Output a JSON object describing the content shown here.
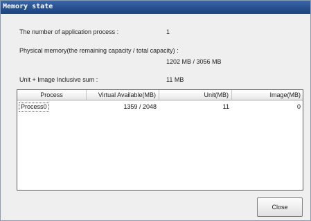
{
  "window": {
    "title": "Memory state"
  },
  "info": {
    "process_count_label": "The number of application process :",
    "process_count_value": "1",
    "physical_memory_label": "Physical memory(the remaining capacity / total capacity) :",
    "physical_memory_value": "1202 MB / 3056 MB",
    "inclusive_sum_label": "Unit + Image Inclusive sum :",
    "inclusive_sum_value": "11 MB"
  },
  "table": {
    "columns": [
      "Process",
      "Virtual Available(MB)",
      "Unit(MB)",
      "Image(MB)"
    ],
    "rows": [
      {
        "process": "Process0",
        "virtual_available": "1359 / 2048",
        "unit": "11",
        "image": "0"
      }
    ]
  },
  "buttons": {
    "close_label": "Close"
  }
}
